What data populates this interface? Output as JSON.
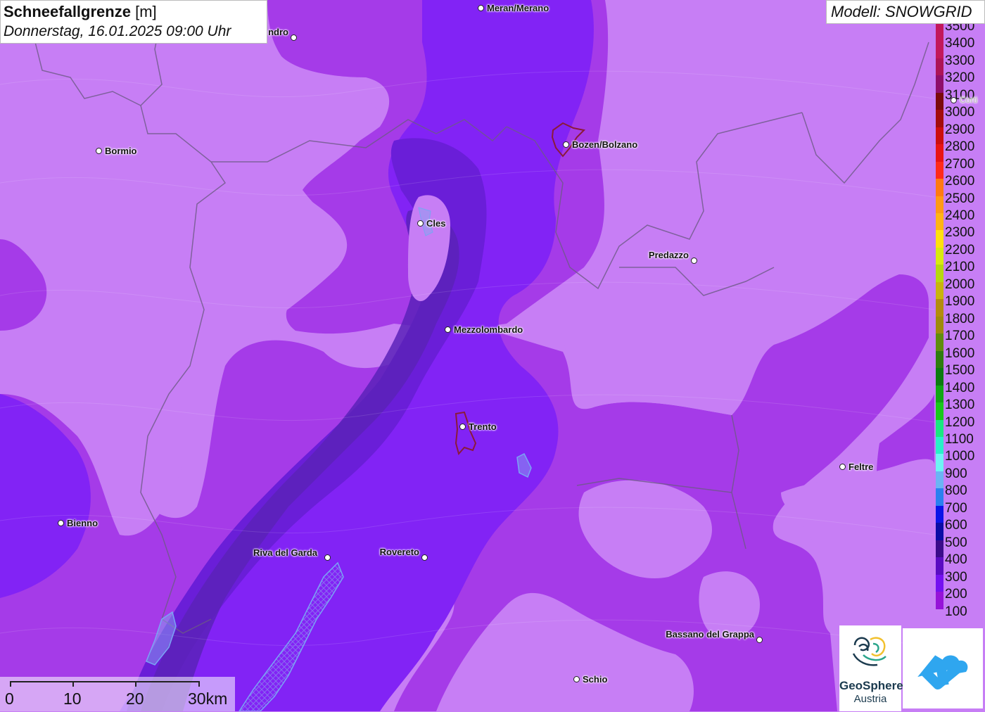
{
  "title": {
    "main": "Schneefallgrenze",
    "unit": "[m]",
    "datetime": "Donnerstag, 16.01.2025 09:00 Uhr"
  },
  "model": "Modell: SNOWGRID",
  "legend": [
    {
      "label": "3500",
      "color": "#c2185b"
    },
    {
      "label": "3400",
      "color": "#c2185b"
    },
    {
      "label": "3300",
      "color": "#ad1457"
    },
    {
      "label": "3200",
      "color": "#8e0e6a"
    },
    {
      "label": "3100",
      "color": "#7a0a0a"
    },
    {
      "label": "3000",
      "color": "#a30c0c"
    },
    {
      "label": "2900",
      "color": "#cc0e0e"
    },
    {
      "label": "2800",
      "color": "#e81414"
    },
    {
      "label": "2700",
      "color": "#ff2a1a"
    },
    {
      "label": "2600",
      "color": "#ff7a12"
    },
    {
      "label": "2500",
      "color": "#ff9a14"
    },
    {
      "label": "2400",
      "color": "#ffb414"
    },
    {
      "label": "2300",
      "color": "#ffe010"
    },
    {
      "label": "2200",
      "color": "#d8ea10"
    },
    {
      "label": "2100",
      "color": "#b6d80e"
    },
    {
      "label": "2000",
      "color": "#c8b40e"
    },
    {
      "label": "1900",
      "color": "#b38c0e"
    },
    {
      "label": "1800",
      "color": "#9e8a0c"
    },
    {
      "label": "1700",
      "color": "#5f8c0e"
    },
    {
      "label": "1600",
      "color": "#2e7c0e"
    },
    {
      "label": "1500",
      "color": "#0c7a10"
    },
    {
      "label": "1400",
      "color": "#10a614"
    },
    {
      "label": "1300",
      "color": "#18c81a"
    },
    {
      "label": "1200",
      "color": "#18e880"
    },
    {
      "label": "1100",
      "color": "#28f0c8"
    },
    {
      "label": "1000",
      "color": "#6ef4f4"
    },
    {
      "label": "900",
      "color": "#6cb4f4"
    },
    {
      "label": "800",
      "color": "#2a80f0"
    },
    {
      "label": "700",
      "color": "#0a14e8"
    },
    {
      "label": "600",
      "color": "#0a0ca6"
    },
    {
      "label": "500",
      "color": "#3a0c8a"
    },
    {
      "label": "400",
      "color": "#5a0cc2"
    },
    {
      "label": "300",
      "color": "#7410f0"
    },
    {
      "label": "200",
      "color": "#9612d8"
    },
    {
      "label": "100",
      "color": "#c77ef5"
    }
  ],
  "cities": [
    {
      "name": "Meran/Merano",
      "key": "meran"
    },
    {
      "name": "ndro",
      "key": "sondrio"
    },
    {
      "name": "Bozen/Bolzano",
      "key": "bozen"
    },
    {
      "name": "Bormio",
      "key": "bormio"
    },
    {
      "name": "Cles",
      "key": "cles"
    },
    {
      "name": "Predazzo",
      "key": "predazzo"
    },
    {
      "name": "Mezzolombardo",
      "key": "mezzolombardo"
    },
    {
      "name": "Trento",
      "key": "trento"
    },
    {
      "name": "Feltre",
      "key": "feltre"
    },
    {
      "name": "Bienno",
      "key": "bienno"
    },
    {
      "name": "Riva del Garda",
      "key": "riva"
    },
    {
      "name": "Rovereto",
      "key": "rovereto"
    },
    {
      "name": "Bassano del Grappa",
      "key": "bassano"
    },
    {
      "name": "Schio",
      "key": "schio"
    },
    {
      "name": "Corti",
      "key": "cortina"
    }
  ],
  "scale": {
    "labels": [
      "0",
      "10",
      "20",
      "30km"
    ]
  },
  "logos": {
    "geosphere_line1": "GeoSphere",
    "geosphere_line2": "Austria"
  }
}
